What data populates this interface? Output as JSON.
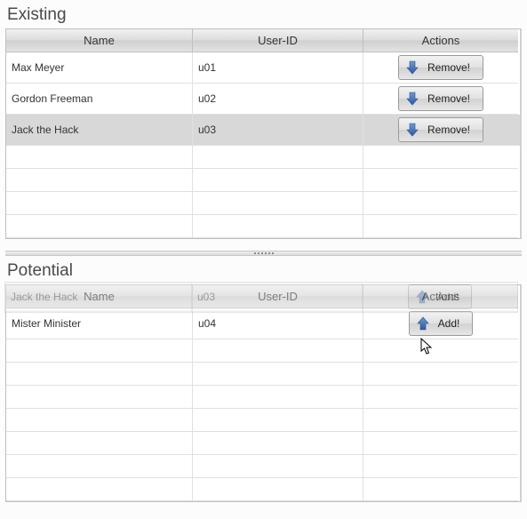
{
  "sections": {
    "existing": {
      "title": "Existing"
    },
    "potential": {
      "title": "Potential"
    }
  },
  "columns": {
    "name": "Name",
    "uid": "User-ID",
    "actions": "Actions"
  },
  "buttons": {
    "remove": "Remove!",
    "add": "Add!"
  },
  "existing_rows": [
    {
      "name": "Max Meyer",
      "uid": "u01"
    },
    {
      "name": "Gordon Freeman",
      "uid": "u02"
    },
    {
      "name": "Jack the Hack",
      "uid": "u03",
      "highlight": true
    }
  ],
  "potential_rows": [
    {
      "name": "Mister Minister",
      "uid": "u04"
    }
  ],
  "drag_ghost": {
    "name": "Jack the Hack",
    "uid": "u03",
    "button": "Add!"
  }
}
